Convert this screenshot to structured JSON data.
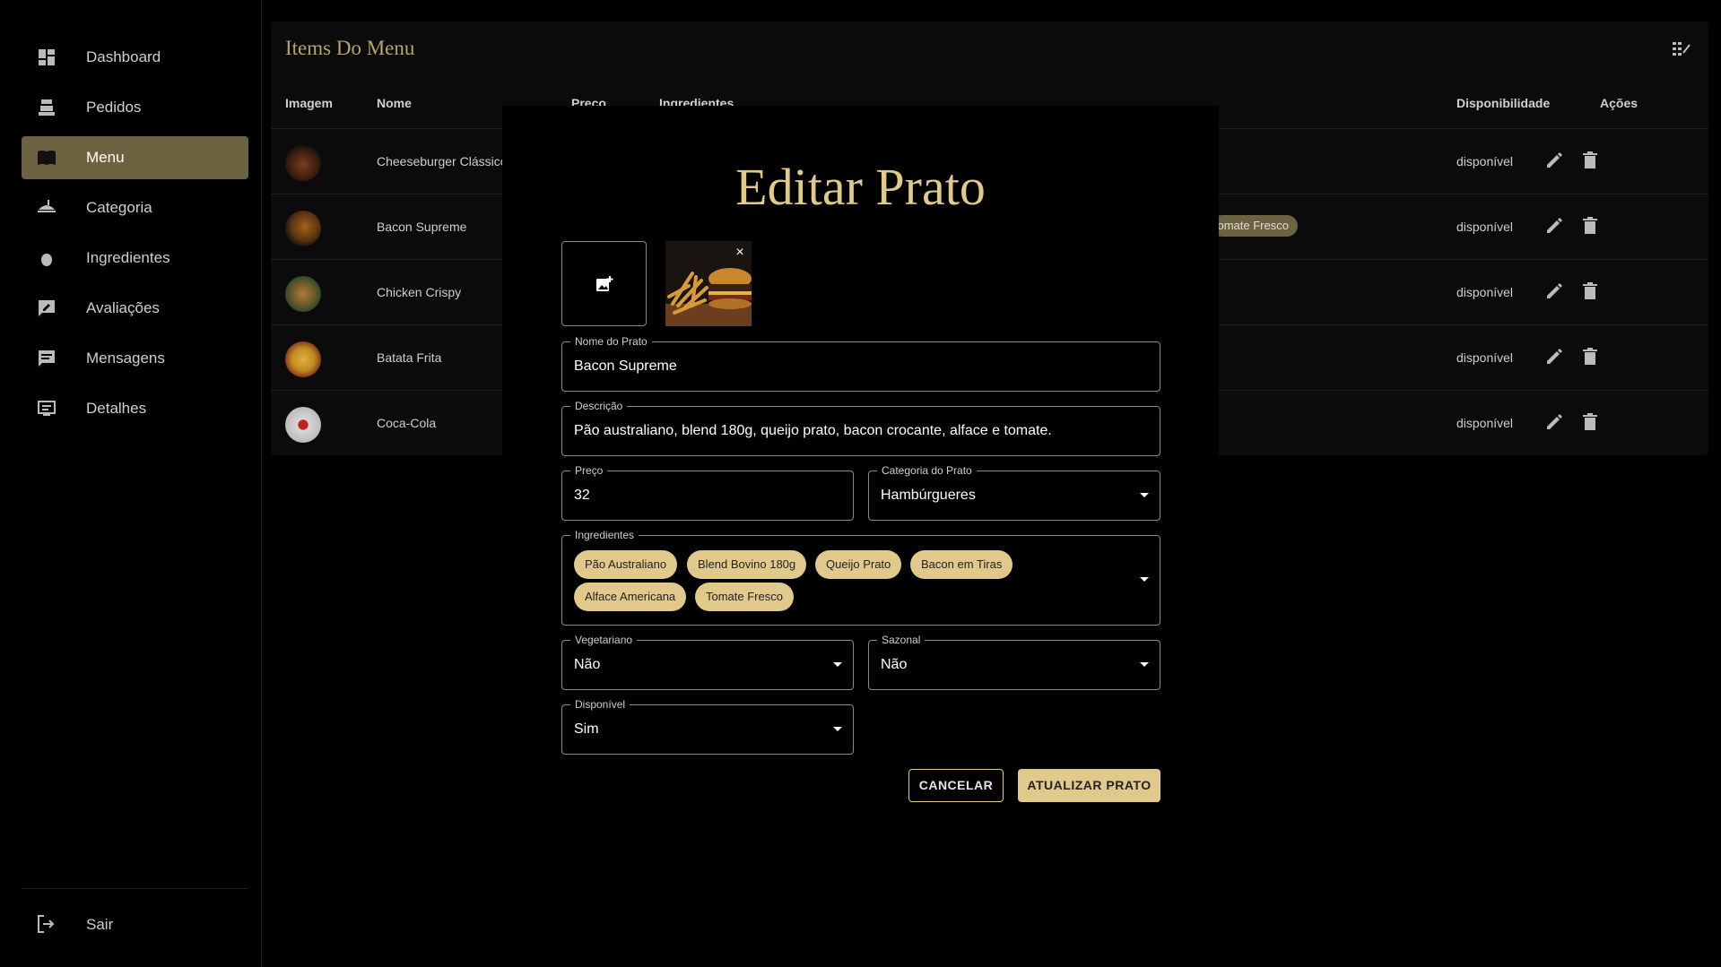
{
  "sidebar": {
    "items": [
      {
        "label": "Dashboard",
        "icon": "dashboard-icon"
      },
      {
        "label": "Pedidos",
        "icon": "register-icon"
      },
      {
        "label": "Menu",
        "icon": "menu-book-icon",
        "active": true
      },
      {
        "label": "Categoria",
        "icon": "dining-icon"
      },
      {
        "label": "Ingredientes",
        "icon": "egg-icon"
      },
      {
        "label": "Avaliações",
        "icon": "rate-review-icon"
      },
      {
        "label": "Mensagens",
        "icon": "chat-icon"
      },
      {
        "label": "Detalhes",
        "icon": "details-icon"
      }
    ],
    "logout_label": "Sair"
  },
  "table": {
    "title": "Items Do Menu",
    "columns": {
      "image": "Imagem",
      "name": "Nome",
      "price": "Preço",
      "ingredients": "Ingredientes",
      "availability": "Disponibilidade",
      "actions": "Ações"
    },
    "rows": [
      {
        "name": "Cheeseburger Clássico",
        "availability": "disponível"
      },
      {
        "name": "Bacon Supreme",
        "availability": "disponível",
        "chip_peek": "Tomate Fresco"
      },
      {
        "name": "Chicken Crispy",
        "availability": "disponível"
      },
      {
        "name": "Batata Frita",
        "availability": "disponível"
      },
      {
        "name": "Coca-Cola",
        "availability": "disponível"
      }
    ]
  },
  "dialog": {
    "title": "Editar Prato",
    "name_label": "Nome do Prato",
    "name_value": "Bacon Supreme",
    "desc_label": "Descrição",
    "desc_value": "Pão australiano, blend 180g, queijo prato, bacon crocante, alface e tomate.",
    "price_label": "Preço",
    "price_value": "32",
    "category_label": "Categoria do Prato",
    "category_value": "Hambúrgueres",
    "ingredients_label": "Ingredientes",
    "ingredients": [
      "Pão Australiano",
      "Blend Bovino 180g",
      "Queijo Prato",
      "Bacon em Tiras",
      "Alface Americana",
      "Tomate Fresco"
    ],
    "vegetarian_label": "Vegetariano",
    "vegetarian_value": "Não",
    "seasonal_label": "Sazonal",
    "seasonal_value": "Não",
    "available_label": "Disponível",
    "available_value": "Sim",
    "cancel_label": "CANCELAR",
    "update_label": "ATUALIZAR PRATO",
    "preview_close": "×"
  },
  "colors": {
    "accent": "#e0c98a",
    "active_nav": "#6e6340",
    "title_gold": "#b8a46c"
  }
}
